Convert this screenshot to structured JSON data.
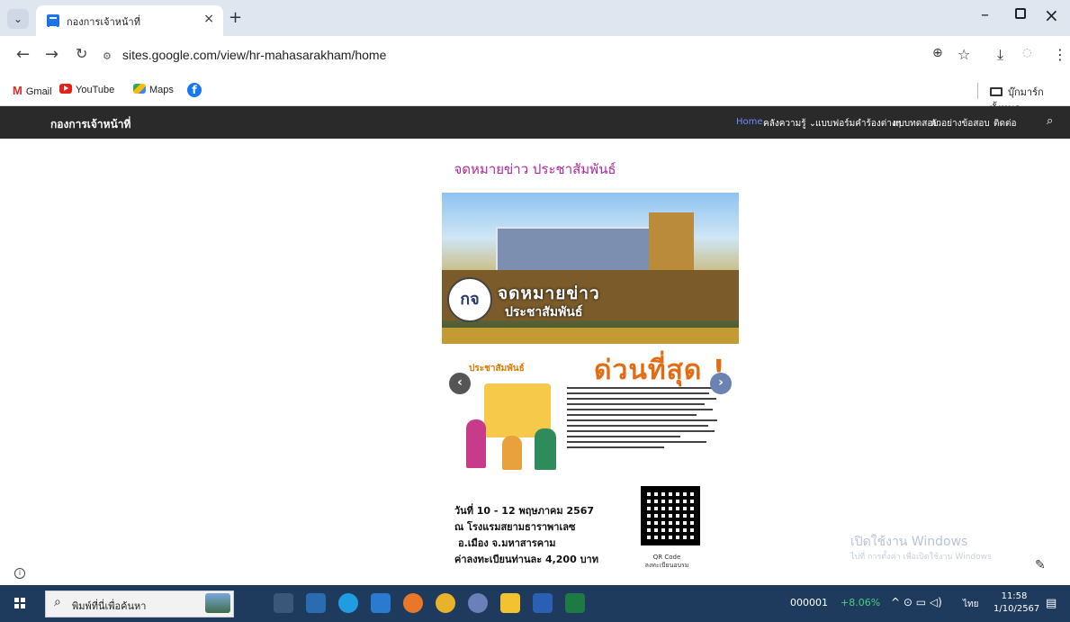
{
  "browser": {
    "tab_title": "กองการเจ้าหน้าที่",
    "tab_close": "×",
    "new_tab": "+",
    "url": "sites.google.com/view/hr-mahasarakham/home",
    "bookmarks": [
      {
        "label": "Gmail"
      },
      {
        "label": "YouTube"
      },
      {
        "label": "Maps"
      }
    ],
    "all_bookmarks_label": "บุ๊กมาร์กทั้งหมด"
  },
  "site": {
    "title": "กองการเจ้าหน้าที่",
    "nav": [
      "Home",
      "คลังความรู้",
      "แบบฟอร์มคำร้องต่างๆ",
      "แบบทดสอบ",
      "ตัวอย่างข้อสอบ",
      "ติดต่อ"
    ],
    "nav_dropdown_marker": "⌄"
  },
  "page": {
    "heading": "จดหมายข่าว ประชาสัมพันธ์",
    "poster": {
      "logo_text": "กจ",
      "title_line1": "จดหมายข่าว",
      "title_line2": "ประชาสัมพันธ์",
      "pr_label": "ประชาสัมพันธ์",
      "urgent_text": "ด่วนที่สุด !",
      "info_date": "วันที่ 10 - 12 พฤษภาคม 2567",
      "info_venue": "ณ โรงแรมสยามธาราพาเลซ",
      "info_district": "อ.เมือง จ.มหาสารคาม",
      "info_fee": "ค่าลงทะเบียนท่านละ 4,200 บาท",
      "qr_caption_line1": "QR Code",
      "qr_caption_line2": "ลงทะเบียนอบรม"
    },
    "carousel_prev": "‹",
    "carousel_next": "›"
  },
  "watermark": {
    "line1": "เปิดใช้งาน Windows",
    "line2": "ไปที่ การตั้งค่า เพื่อเปิดใช้งาน Windows"
  },
  "taskbar": {
    "search_placeholder": "พิมพ์ที่นี่เพื่อค้นหา",
    "stock_code": "000001",
    "stock_change": "+8.06%",
    "language": "ไทย",
    "time": "11:58",
    "date": "1/10/2567"
  },
  "colors": {
    "site_header_bg": "#2a2a2a",
    "heading": "#b0269e",
    "urgent": "#e26b13",
    "taskbar_bg": "#1e3a5c",
    "nav_active": "#6a8cff"
  },
  "icons": [
    "tab-menu-icon",
    "favicon-icon",
    "back-icon",
    "forward-icon",
    "reload-icon",
    "site-info-icon",
    "zoom-icon",
    "star-icon",
    "download-icon",
    "extension-icon",
    "menu-icon",
    "folder-icon",
    "search-icon",
    "windows-start-icon",
    "notification-icon"
  ]
}
